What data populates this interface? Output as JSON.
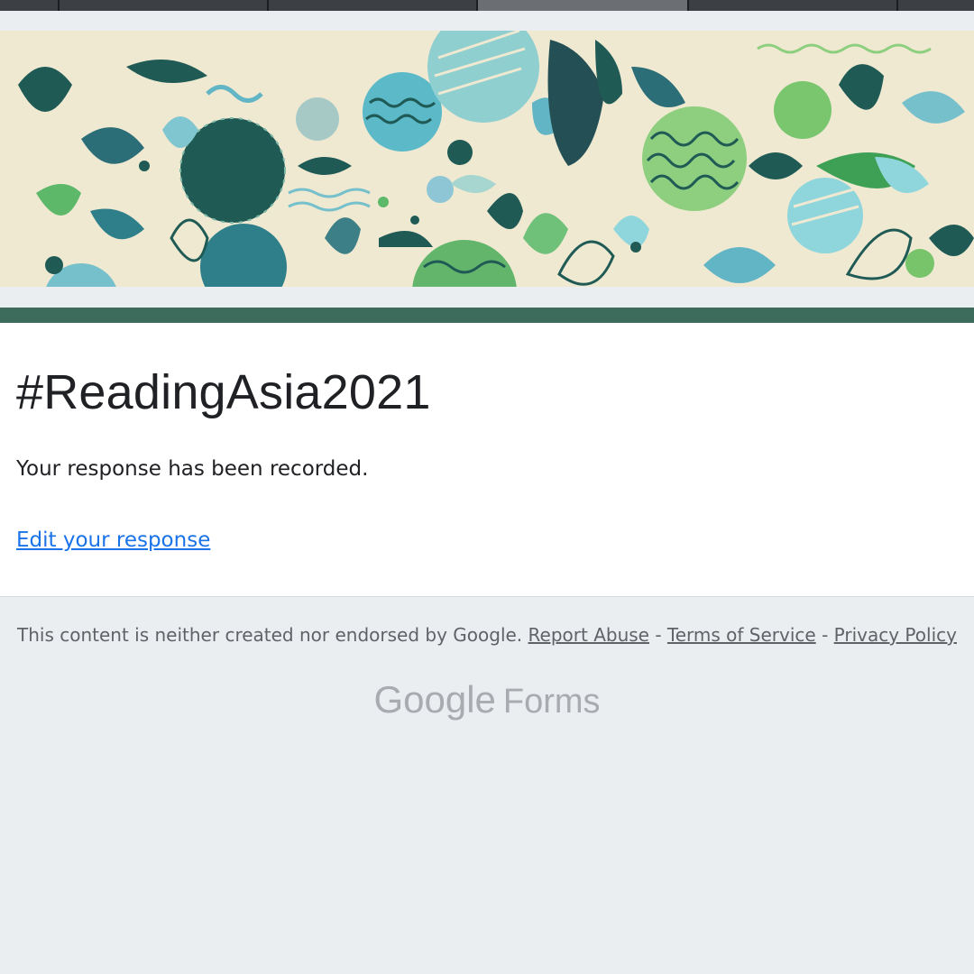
{
  "theme": {
    "accent": "#3d6b5c",
    "link_color": "#1a73e8",
    "page_bg": "#ebeef0"
  },
  "header": {
    "banner_icon": "decorative-pattern-banner"
  },
  "form": {
    "title": "#ReadingAsia2021",
    "confirmation": "Your response has been recorded.",
    "edit_link": "Edit your response"
  },
  "footer": {
    "disclaimer": "This content is neither created nor endorsed by Google.",
    "report_abuse": "Report Abuse",
    "separator": "-",
    "terms": "Terms of Service",
    "privacy": "Privacy Policy"
  },
  "brand": {
    "google": "Google",
    "forms": "Forms"
  }
}
